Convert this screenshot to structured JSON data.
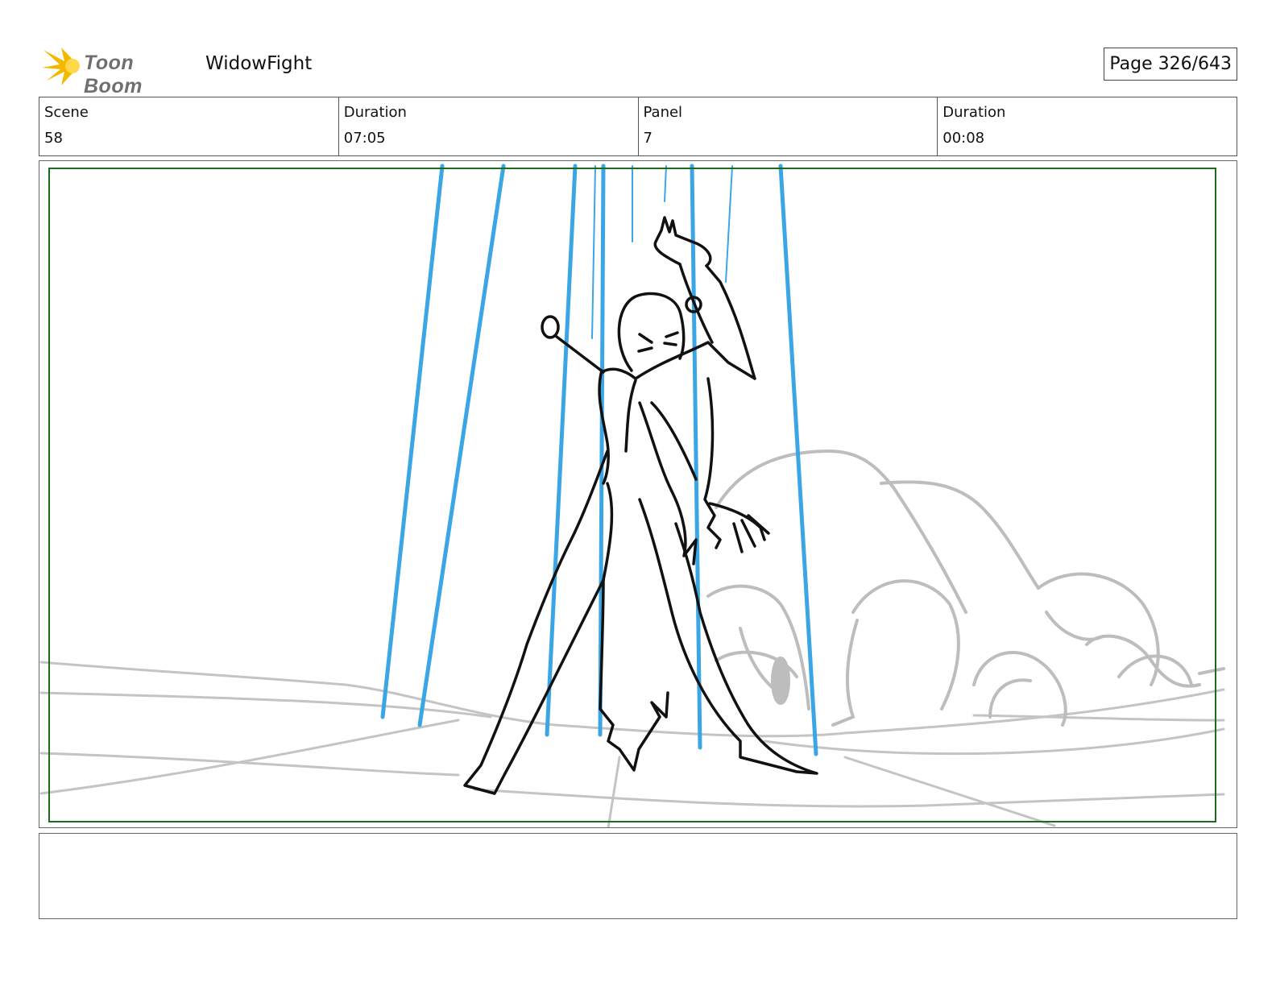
{
  "header": {
    "logo_text": "Toon Boom",
    "project_title": "WidowFight",
    "page_label": "Page 326/643"
  },
  "info": {
    "scene_label": "Scene",
    "scene_value": "58",
    "scene_duration_label": "Duration",
    "scene_duration_value": "07:05",
    "panel_label": "Panel",
    "panel_value": "7",
    "panel_duration_label": "Duration",
    "panel_duration_value": "00:08"
  },
  "colors": {
    "safe_frame": "#1e6b1e",
    "speed_lines": "#3aa6e6",
    "character_ink": "#111111",
    "background_sketch": "#bdbdbd",
    "logo_accent": "#f5b800"
  },
  "notes": {
    "text": ""
  }
}
